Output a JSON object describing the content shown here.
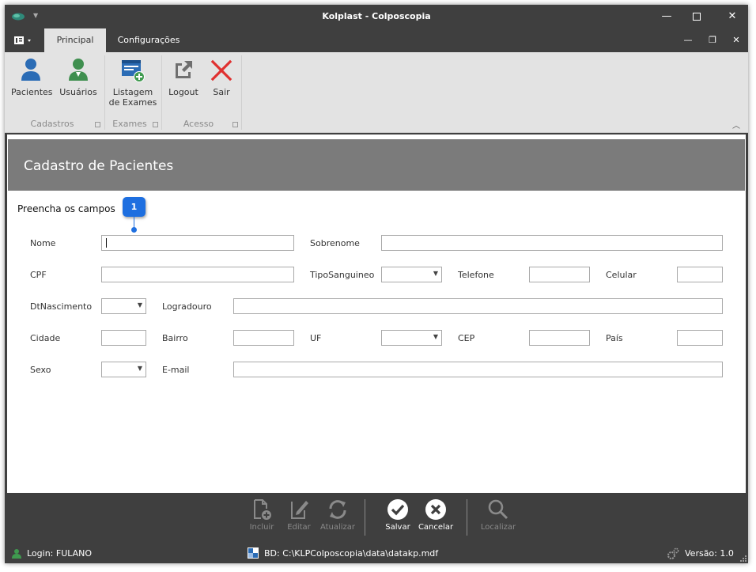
{
  "window": {
    "title": "Kolplast - Colposcopia"
  },
  "tabs": [
    {
      "label": "Principal",
      "active": true
    },
    {
      "label": "Configurações",
      "active": false
    }
  ],
  "ribbon": {
    "groups": [
      {
        "label": "Cadastros",
        "buttons": [
          {
            "label": "Pacientes",
            "icon": "person-icon"
          },
          {
            "label": "Usuários",
            "icon": "user-icon"
          }
        ]
      },
      {
        "label": "Exames",
        "buttons": [
          {
            "label_line1": "Listagem",
            "label_line2": "de Exames",
            "icon": "exam-list-icon"
          }
        ]
      },
      {
        "label": "Acesso",
        "buttons": [
          {
            "label": "Logout",
            "icon": "logout-icon"
          },
          {
            "label": "Sair",
            "icon": "exit-icon"
          }
        ]
      }
    ]
  },
  "form": {
    "title": "Cadastro de Pacientes",
    "instruction": "Preencha os campos",
    "badge": "1",
    "labels": {
      "nome": "Nome",
      "sobrenome": "Sobrenome",
      "cpf": "CPF",
      "tipo_sanguineo": "TipoSanguineo",
      "telefone": "Telefone",
      "celular": "Celular",
      "dt_nascimento": "DtNascimento",
      "logradouro": "Logradouro",
      "cidade": "Cidade",
      "bairro": "Bairro",
      "uf": "UF",
      "cep": "CEP",
      "pais": "País",
      "sexo": "Sexo",
      "email": "E-mail"
    }
  },
  "toolbar": {
    "incluir": "Incluir",
    "editar": "Editar",
    "atualizar": "Atualizar",
    "salvar": "Salvar",
    "cancelar": "Cancelar",
    "localizar": "Localizar"
  },
  "status": {
    "login": "Login: FULANO",
    "database": "BD: C:\\KLPColposcopia\\data\\datakp.mdf",
    "version": "Versão: 1.0"
  },
  "colors": {
    "accent_blue": "#2b6cb5",
    "accent_green": "#3f8f4f",
    "exit_red": "#e0302f",
    "badge_blue": "#1e6fe0",
    "dark_chrome": "#3f3f3f",
    "ribbon_bg": "#e3e3e3",
    "header_band": "#7b7b7b"
  }
}
